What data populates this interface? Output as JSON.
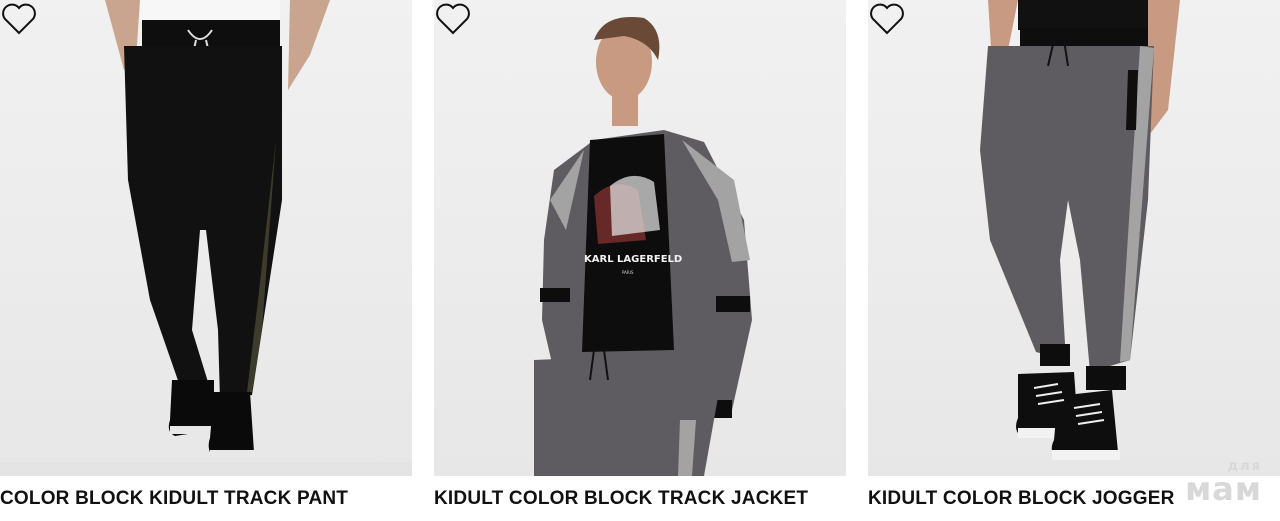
{
  "products": [
    {
      "title": "COLOR BLOCK KIDULT TRACK PANT",
      "favorite_icon": "heart-outline-icon"
    },
    {
      "title": "KIDULT COLOR BLOCK TRACK JACKET",
      "favorite_icon": "heart-outline-icon",
      "shirt_print": "KARL LAGERFELD",
      "shirt_print_sub": "PARIS"
    },
    {
      "title": "KIDULT COLOR BLOCK JOGGER",
      "favorite_icon": "heart-outline-icon"
    }
  ],
  "watermark": {
    "top": "для",
    "main": "мам"
  },
  "colors": {
    "background": "#ffffff",
    "photo_bg": "#ececec",
    "text": "#111111",
    "charcoal": "#5a585c",
    "stripe": "#a3a3a3"
  }
}
